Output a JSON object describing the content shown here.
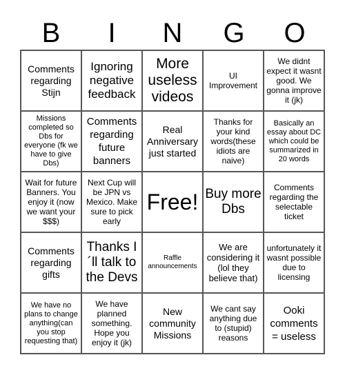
{
  "title_letters": [
    "B",
    "I",
    "N",
    "G",
    "O"
  ],
  "cells": [
    [
      "Comments regarding Stijn",
      "Ignoring negative feedback",
      "More useless videos",
      "UI Improvement",
      "We didnt expect it wasnt good. We gonna improve it (jk)"
    ],
    [
      "Missions completed so Dbs for everyone (fk we have to give Dbs)",
      "Comments regarding future banners",
      "Real Anniversary just started",
      "Thanks for your kind words(these idiots are naive)",
      "Basically an essay about DC which could be summarized in 20 words"
    ],
    [
      "Wait for future Banners. You enjoy it (now we want your $$$)",
      "Next Cup will be JPN vs Mexico. Make sure to pick early",
      "Free!",
      "Buy more Dbs",
      "Comments regarding the selectable ticket"
    ],
    [
      "Comments regarding gifts",
      "Thanks I ´ll talk to the Devs",
      "Raffle announcements",
      "We are considering it (lol they believe that)",
      "unfortunately it wasnt possible due to licensing"
    ],
    [
      "We have no plans to change anything(can you stop requesting that)",
      "We have planned something. Hope you enjoy it (jk)",
      "New community Missions",
      "We cant say anything due to (stupid) reasons",
      "Ooki comments = useless"
    ]
  ]
}
